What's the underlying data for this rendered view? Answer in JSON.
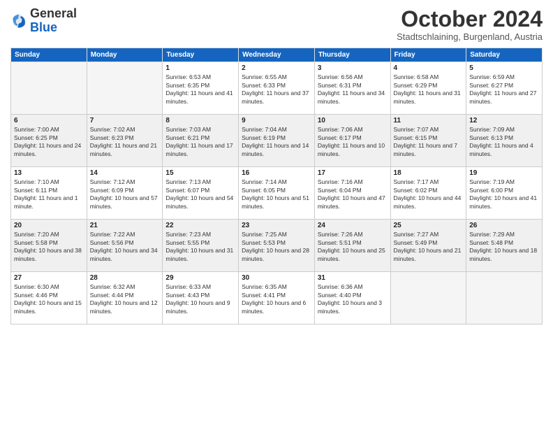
{
  "header": {
    "logo_general": "General",
    "logo_blue": "Blue",
    "month": "October 2024",
    "location": "Stadtschlaining, Burgenland, Austria"
  },
  "days_of_week": [
    "Sunday",
    "Monday",
    "Tuesday",
    "Wednesday",
    "Thursday",
    "Friday",
    "Saturday"
  ],
  "weeks": [
    [
      {
        "day": "",
        "info": ""
      },
      {
        "day": "",
        "info": ""
      },
      {
        "day": "1",
        "info": "Sunrise: 6:53 AM\nSunset: 6:35 PM\nDaylight: 11 hours and 41 minutes."
      },
      {
        "day": "2",
        "info": "Sunrise: 6:55 AM\nSunset: 6:33 PM\nDaylight: 11 hours and 37 minutes."
      },
      {
        "day": "3",
        "info": "Sunrise: 6:56 AM\nSunset: 6:31 PM\nDaylight: 11 hours and 34 minutes."
      },
      {
        "day": "4",
        "info": "Sunrise: 6:58 AM\nSunset: 6:29 PM\nDaylight: 11 hours and 31 minutes."
      },
      {
        "day": "5",
        "info": "Sunrise: 6:59 AM\nSunset: 6:27 PM\nDaylight: 11 hours and 27 minutes."
      }
    ],
    [
      {
        "day": "6",
        "info": "Sunrise: 7:00 AM\nSunset: 6:25 PM\nDaylight: 11 hours and 24 minutes."
      },
      {
        "day": "7",
        "info": "Sunrise: 7:02 AM\nSunset: 6:23 PM\nDaylight: 11 hours and 21 minutes."
      },
      {
        "day": "8",
        "info": "Sunrise: 7:03 AM\nSunset: 6:21 PM\nDaylight: 11 hours and 17 minutes."
      },
      {
        "day": "9",
        "info": "Sunrise: 7:04 AM\nSunset: 6:19 PM\nDaylight: 11 hours and 14 minutes."
      },
      {
        "day": "10",
        "info": "Sunrise: 7:06 AM\nSunset: 6:17 PM\nDaylight: 11 hours and 10 minutes."
      },
      {
        "day": "11",
        "info": "Sunrise: 7:07 AM\nSunset: 6:15 PM\nDaylight: 11 hours and 7 minutes."
      },
      {
        "day": "12",
        "info": "Sunrise: 7:09 AM\nSunset: 6:13 PM\nDaylight: 11 hours and 4 minutes."
      }
    ],
    [
      {
        "day": "13",
        "info": "Sunrise: 7:10 AM\nSunset: 6:11 PM\nDaylight: 11 hours and 1 minute."
      },
      {
        "day": "14",
        "info": "Sunrise: 7:12 AM\nSunset: 6:09 PM\nDaylight: 10 hours and 57 minutes."
      },
      {
        "day": "15",
        "info": "Sunrise: 7:13 AM\nSunset: 6:07 PM\nDaylight: 10 hours and 54 minutes."
      },
      {
        "day": "16",
        "info": "Sunrise: 7:14 AM\nSunset: 6:05 PM\nDaylight: 10 hours and 51 minutes."
      },
      {
        "day": "17",
        "info": "Sunrise: 7:16 AM\nSunset: 6:04 PM\nDaylight: 10 hours and 47 minutes."
      },
      {
        "day": "18",
        "info": "Sunrise: 7:17 AM\nSunset: 6:02 PM\nDaylight: 10 hours and 44 minutes."
      },
      {
        "day": "19",
        "info": "Sunrise: 7:19 AM\nSunset: 6:00 PM\nDaylight: 10 hours and 41 minutes."
      }
    ],
    [
      {
        "day": "20",
        "info": "Sunrise: 7:20 AM\nSunset: 5:58 PM\nDaylight: 10 hours and 38 minutes."
      },
      {
        "day": "21",
        "info": "Sunrise: 7:22 AM\nSunset: 5:56 PM\nDaylight: 10 hours and 34 minutes."
      },
      {
        "day": "22",
        "info": "Sunrise: 7:23 AM\nSunset: 5:55 PM\nDaylight: 10 hours and 31 minutes."
      },
      {
        "day": "23",
        "info": "Sunrise: 7:25 AM\nSunset: 5:53 PM\nDaylight: 10 hours and 28 minutes."
      },
      {
        "day": "24",
        "info": "Sunrise: 7:26 AM\nSunset: 5:51 PM\nDaylight: 10 hours and 25 minutes."
      },
      {
        "day": "25",
        "info": "Sunrise: 7:27 AM\nSunset: 5:49 PM\nDaylight: 10 hours and 21 minutes."
      },
      {
        "day": "26",
        "info": "Sunrise: 7:29 AM\nSunset: 5:48 PM\nDaylight: 10 hours and 18 minutes."
      }
    ],
    [
      {
        "day": "27",
        "info": "Sunrise: 6:30 AM\nSunset: 4:46 PM\nDaylight: 10 hours and 15 minutes."
      },
      {
        "day": "28",
        "info": "Sunrise: 6:32 AM\nSunset: 4:44 PM\nDaylight: 10 hours and 12 minutes."
      },
      {
        "day": "29",
        "info": "Sunrise: 6:33 AM\nSunset: 4:43 PM\nDaylight: 10 hours and 9 minutes."
      },
      {
        "day": "30",
        "info": "Sunrise: 6:35 AM\nSunset: 4:41 PM\nDaylight: 10 hours and 6 minutes."
      },
      {
        "day": "31",
        "info": "Sunrise: 6:36 AM\nSunset: 4:40 PM\nDaylight: 10 hours and 3 minutes."
      },
      {
        "day": "",
        "info": ""
      },
      {
        "day": "",
        "info": ""
      }
    ]
  ]
}
